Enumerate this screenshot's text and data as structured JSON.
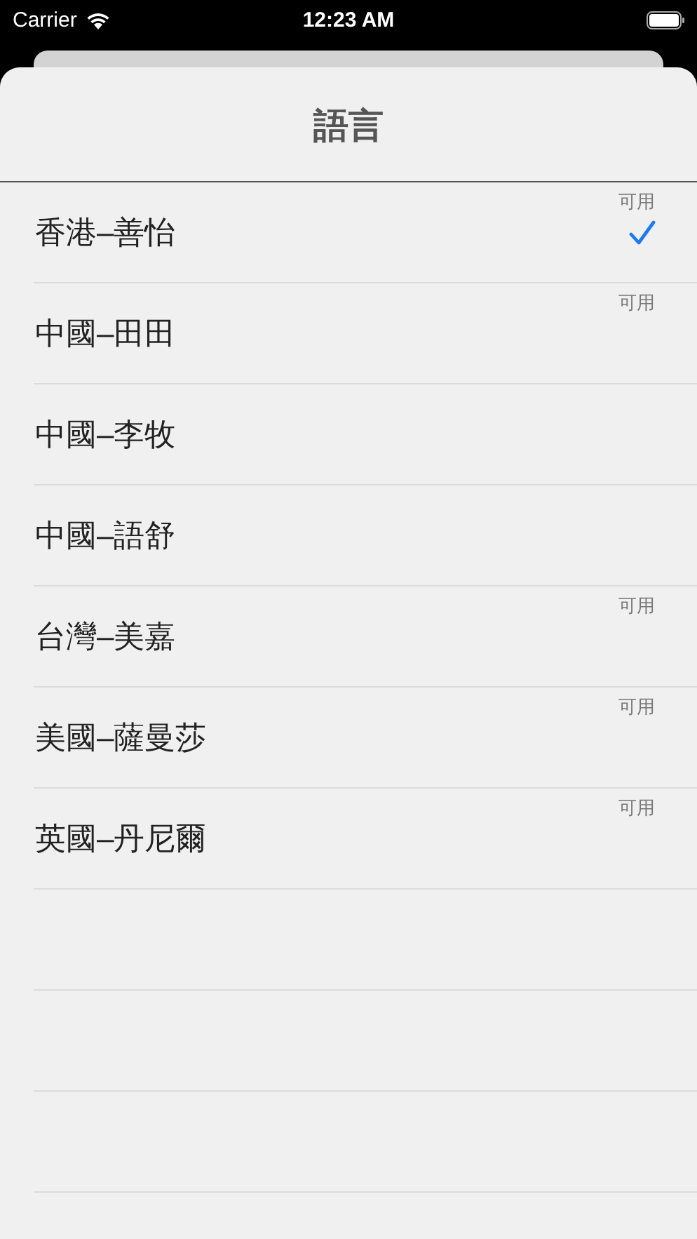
{
  "status_bar": {
    "carrier": "Carrier",
    "time": "12:23 AM"
  },
  "sheet": {
    "title": "語言"
  },
  "voices": [
    {
      "name": "香港–善怡",
      "badge": "可用",
      "selected": true
    },
    {
      "name": "中國–田田",
      "badge": "可用",
      "selected": false
    },
    {
      "name": "中國–李牧",
      "selected": false
    },
    {
      "name": "中國–語舒",
      "selected": false
    },
    {
      "name": "台灣–美嘉",
      "badge": "可用",
      "selected": false
    },
    {
      "name": "美國–薩曼莎",
      "badge": "可用",
      "selected": false
    },
    {
      "name": "英國–丹尼爾",
      "badge": "可用",
      "selected": false
    }
  ]
}
